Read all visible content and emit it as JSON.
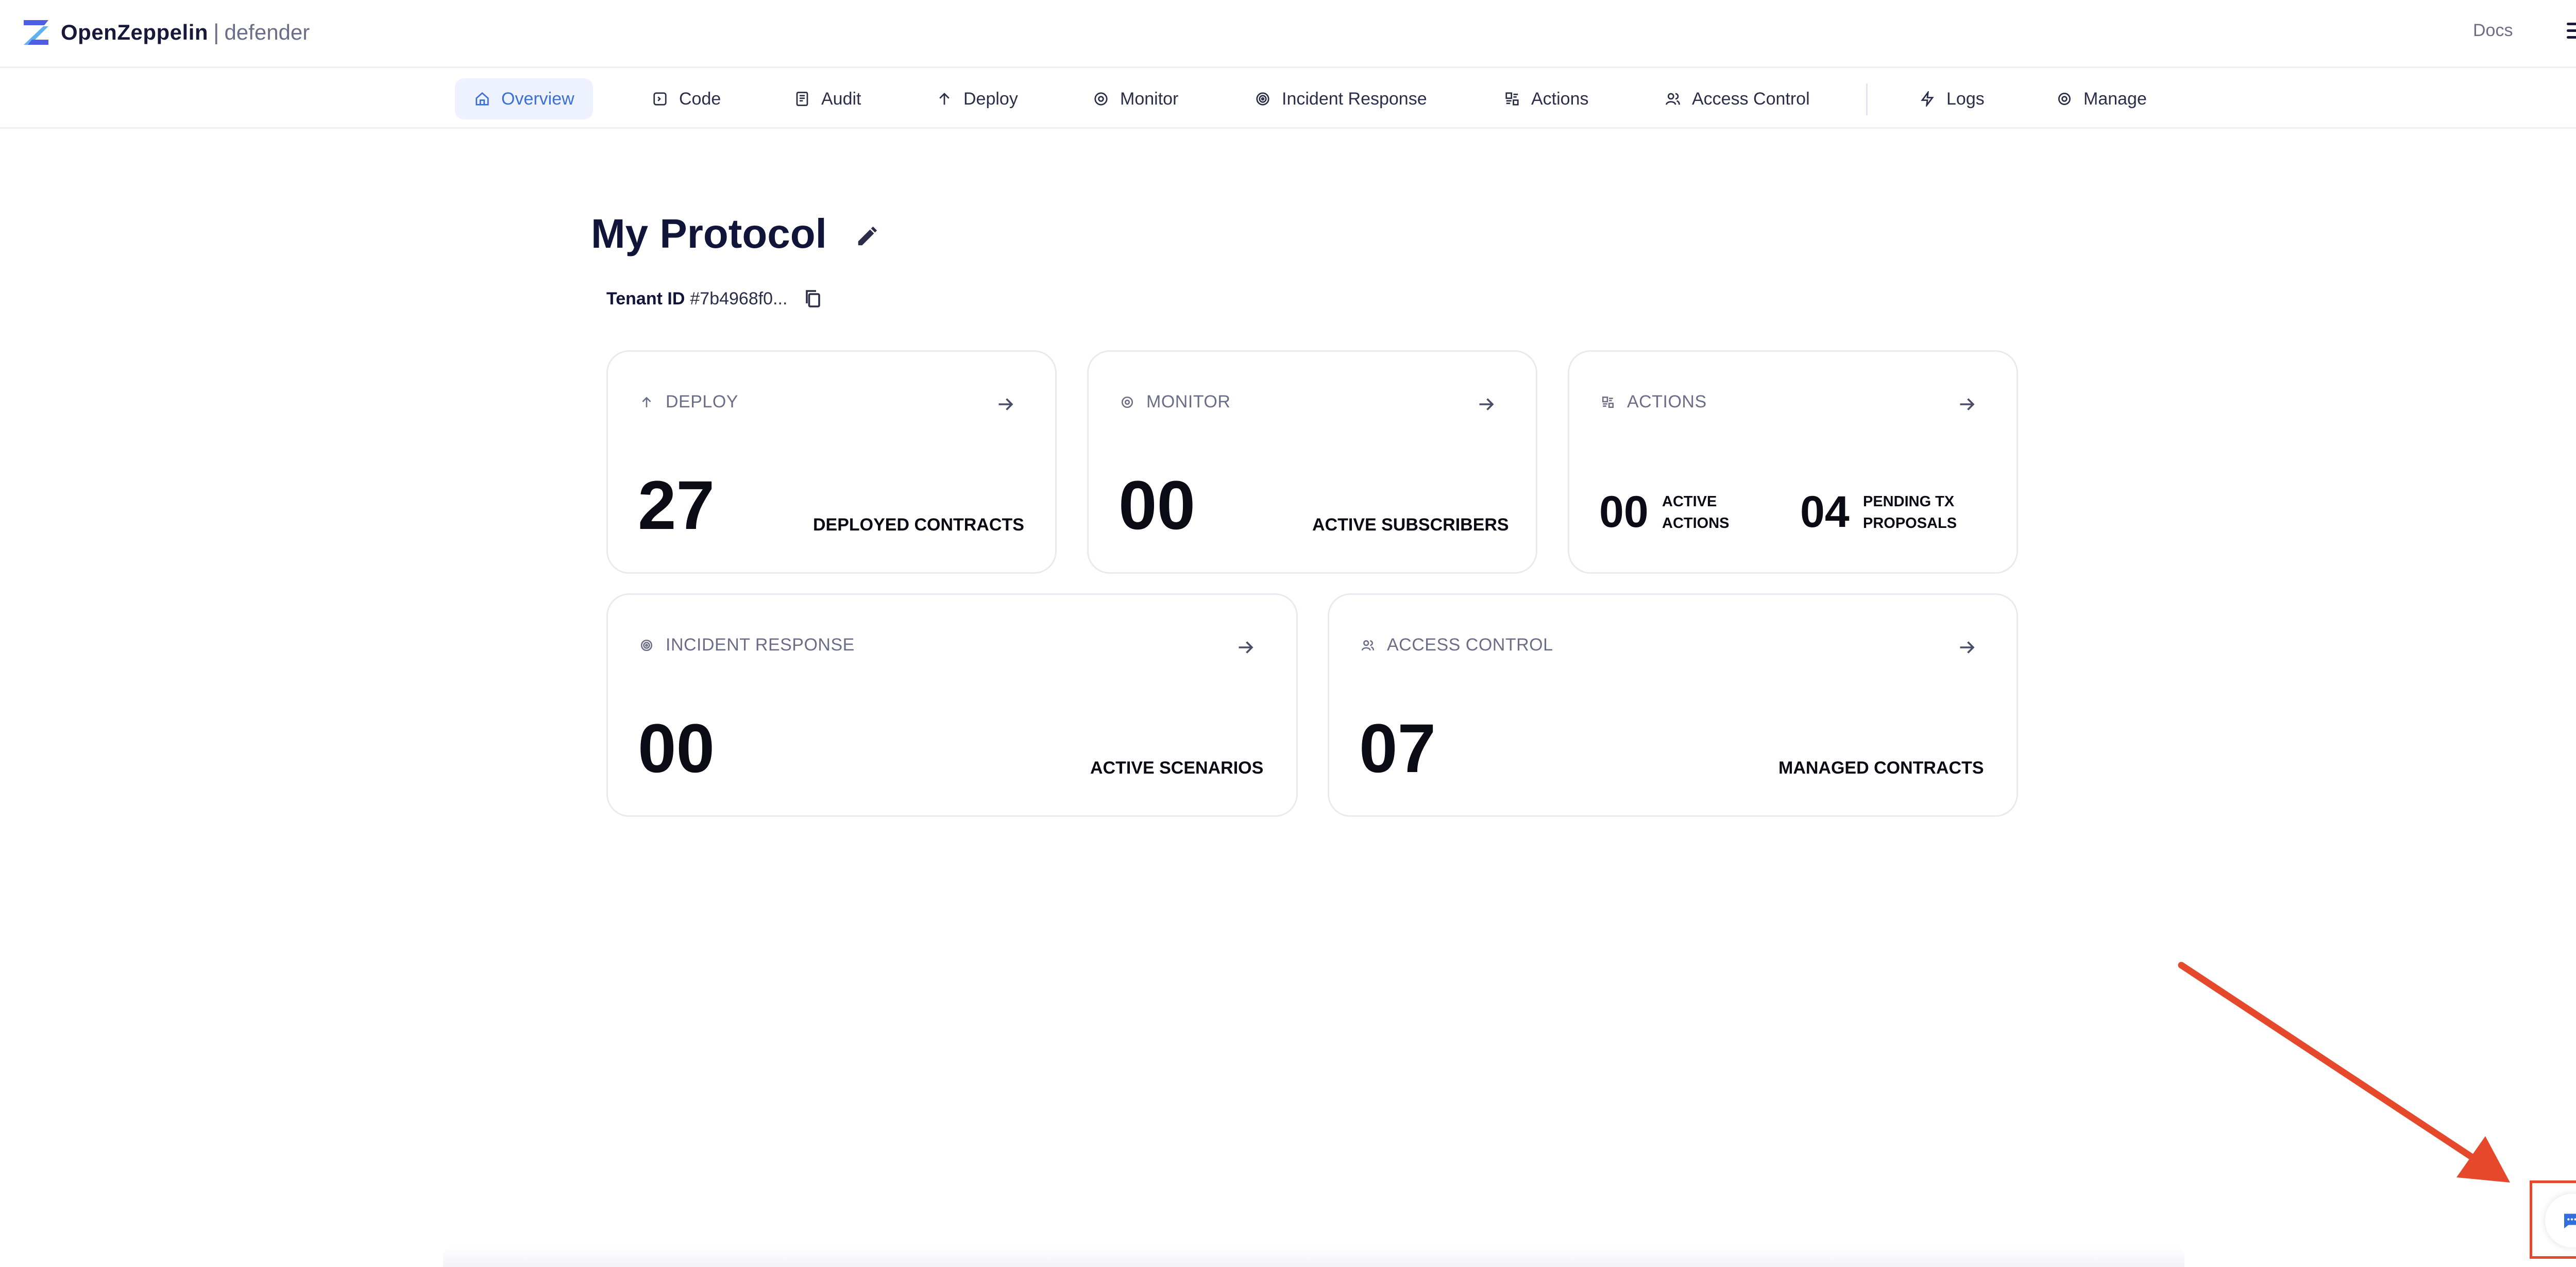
{
  "brand": {
    "name": "OpenZeppelin",
    "separator": "|",
    "product": "defender"
  },
  "header": {
    "docs_label": "Docs"
  },
  "nav": {
    "items": [
      {
        "label": "Overview",
        "icon": "home-icon"
      },
      {
        "label": "Code",
        "icon": "code-icon"
      },
      {
        "label": "Audit",
        "icon": "audit-icon"
      },
      {
        "label": "Deploy",
        "icon": "arrow-up-icon"
      },
      {
        "label": "Monitor",
        "icon": "eye-icon"
      },
      {
        "label": "Incident Response",
        "icon": "target-icon"
      },
      {
        "label": "Actions",
        "icon": "actions-icon"
      },
      {
        "label": "Access Control",
        "icon": "users-icon"
      },
      {
        "label": "Logs",
        "icon": "lightning-icon"
      },
      {
        "label": "Manage",
        "icon": "gear-icon"
      }
    ]
  },
  "page": {
    "title": "My Protocol",
    "tenant_label": "Tenant ID",
    "tenant_value": "#7b4968f0..."
  },
  "cards": {
    "deploy": {
      "title": "DEPLOY",
      "value": "27",
      "label": "DEPLOYED CONTRACTS"
    },
    "monitor": {
      "title": "MONITOR",
      "value": "00",
      "label": "ACTIVE SUBSCRIBERS"
    },
    "actions": {
      "title": "ACTIONS",
      "active_value": "00",
      "active_label_1": "ACTIVE",
      "active_label_2": "ACTIONS",
      "pending_value": "04",
      "pending_label_1": "PENDING TX",
      "pending_label_2": "PROPOSALS"
    },
    "incident": {
      "title": "INCIDENT RESPONSE",
      "value": "00",
      "label": "ACTIVE SCENARIOS"
    },
    "access": {
      "title": "ACCESS CONTROL",
      "value": "07",
      "label": "MANAGED CONTRACTS"
    }
  },
  "colors": {
    "accent": "#3b6fd8",
    "annotation": "#e5482a",
    "text_muted": "#6b6e86"
  }
}
